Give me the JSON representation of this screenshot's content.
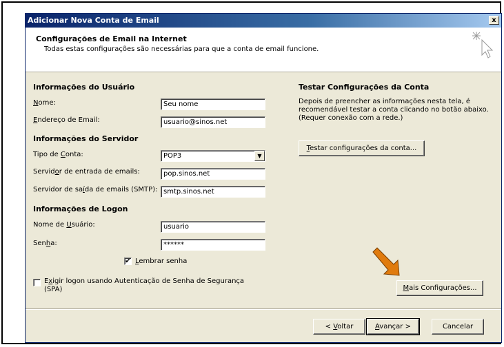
{
  "window": {
    "title": "Adicionar Nova Conta de Email",
    "close_symbol": "x"
  },
  "header": {
    "title": "Configurações de Email na Internet",
    "subtitle": "Todas estas configurações são necessárias para que a conta de email funcione.",
    "icon": "cursor-sparkle-icon"
  },
  "user_info": {
    "heading": "Informações do Usuário",
    "name_label_ul": "N",
    "name_label_rest": "ome:",
    "name_value": "Seu nome",
    "email_label_ul": "E",
    "email_label_rest": "ndereço de Email:",
    "email_value": "usuario@sinos.net"
  },
  "server_info": {
    "heading": "Informações do Servidor",
    "type_label_pre": "Tipo de ",
    "type_label_ul": "C",
    "type_label_rest": "onta:",
    "type_value": "POP3",
    "incoming_label_pre": "Servid",
    "incoming_label_ul": "o",
    "incoming_label_rest": "r de entrada de emails:",
    "incoming_value": "pop.sinos.net",
    "outgoing_label_pre": "Servidor de sa",
    "outgoing_label_ul": "í",
    "outgoing_label_rest": "da de emails (SMTP):",
    "outgoing_value": "smtp.sinos.net"
  },
  "logon_info": {
    "heading": "Informações de Logon",
    "user_label_pre": "Nome de ",
    "user_label_ul": "U",
    "user_label_rest": "suário:",
    "user_value": "usuario",
    "password_label_pre": "Sen",
    "password_label_ul": "h",
    "password_label_rest": "a:",
    "password_value": "******",
    "remember_checked": true,
    "remember_label_ul": "L",
    "remember_label_rest": "embrar senha",
    "spa_checked": false,
    "spa_label_pre": "E",
    "spa_label_ul": "x",
    "spa_label_rest": "igir logon usando Autenticação de Senha de Segurança",
    "spa_label_line2": "(SPA)"
  },
  "test_section": {
    "heading": "Testar Configurações da Conta",
    "description_1": "Depois de preencher as informações nesta tela, é",
    "description_2": "recomendável testar a conta clicando no botão abaixo.",
    "description_3": "(Requer conexão com a rede.)",
    "button_ul": "T",
    "button_rest": "estar configurações da conta..."
  },
  "more_settings": {
    "button_ul": "M",
    "button_rest": "ais Configurações..."
  },
  "footer": {
    "back_pre": "< ",
    "back_ul": "V",
    "back_rest": "oltar",
    "next_ul": "A",
    "next_rest": "vançar >",
    "cancel": "Cancelar"
  },
  "annotation": {
    "arrow_color": "#e07b0e",
    "arrow_icon": "orange-arrow-icon"
  }
}
